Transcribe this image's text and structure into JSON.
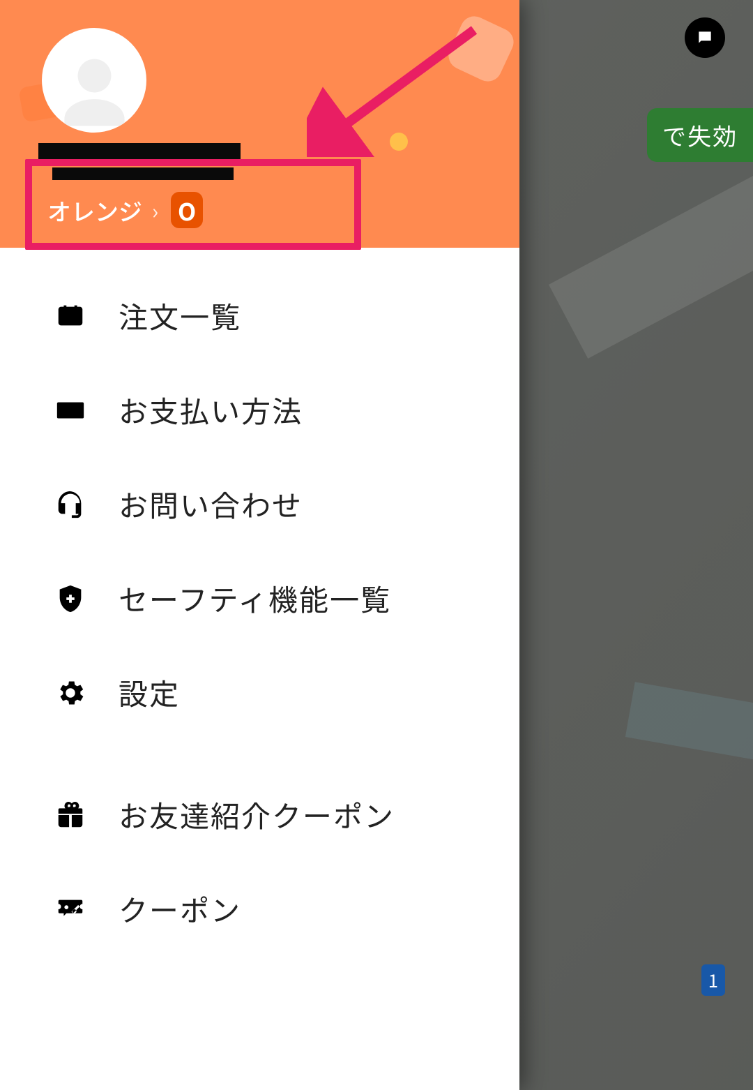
{
  "header": {
    "tier_label": "オレンジ",
    "badge_letter": "O"
  },
  "background": {
    "badge_text": "で失効",
    "route_tag": "1"
  },
  "menu": {
    "items": [
      {
        "label": "注文一覧"
      },
      {
        "label": "お支払い方法"
      },
      {
        "label": "お問い合わせ"
      },
      {
        "label": "セーフティ機能一覧"
      },
      {
        "label": "設定"
      },
      {
        "label": "お友達紹介クーポン"
      },
      {
        "label": "クーポン"
      }
    ]
  }
}
